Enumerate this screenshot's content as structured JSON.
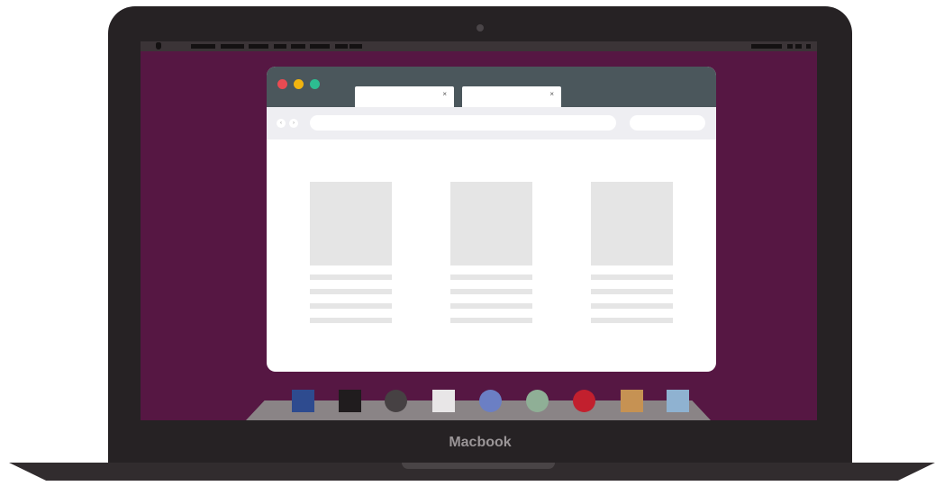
{
  "device": {
    "brand_label": "Macbook"
  },
  "browser": {
    "tabs": [
      {
        "close_label": "×"
      },
      {
        "close_label": "×"
      }
    ],
    "nav": {
      "back_label": "‹",
      "forward_label": "›"
    }
  },
  "cards_count_note": "",
  "dock": {
    "icons": [
      {
        "icon": "blue-square-icon",
        "color": "#2e4b8f"
      },
      {
        "icon": "black-square-icon",
        "color": "#201c1e"
      },
      {
        "icon": "dark-circle-icon",
        "color": "#464143"
      },
      {
        "icon": "white-square-icon",
        "color": "#e8e6e7"
      },
      {
        "icon": "blue-circle-icon",
        "color": "#6b7fc4"
      },
      {
        "icon": "green-circle-icon",
        "color": "#8faf96"
      },
      {
        "icon": "red-circle-icon",
        "color": "#c2202e"
      },
      {
        "icon": "orange-square-icon",
        "color": "#c69253"
      },
      {
        "icon": "light-blue-square-icon",
        "color": "#8fb2d1"
      }
    ]
  },
  "colors": {
    "desktop": "#561743",
    "laptop_body": "#262224",
    "window_titlebar": "#4b575c",
    "traffic_red": "#e94b52",
    "traffic_yellow": "#f1b40f",
    "traffic_green": "#2dbd91"
  }
}
